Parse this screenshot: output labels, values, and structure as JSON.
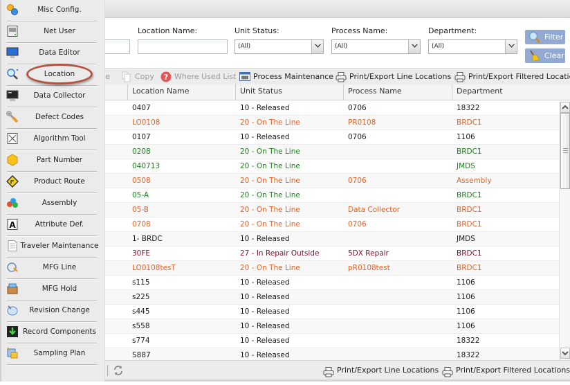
{
  "sidebar": {
    "items": [
      {
        "label": "Misc Config.",
        "icon": "gears-icon"
      },
      {
        "label": "Net User",
        "icon": "server-icon"
      },
      {
        "label": "Data Editor",
        "icon": "monitor-icon"
      },
      {
        "label": "Location",
        "icon": "magnifier-icon",
        "highlighted": true
      },
      {
        "label": "Data Collector",
        "icon": "terminal-icon"
      },
      {
        "label": "Defect Codes",
        "icon": "wrench-icon"
      },
      {
        "label": "Algorithm Tool",
        "icon": "algorithm-icon"
      },
      {
        "label": "Part Number",
        "icon": "hexagon-icon"
      },
      {
        "label": "Product Route",
        "icon": "route-sign-icon"
      },
      {
        "label": "Assembly",
        "icon": "molecules-icon"
      },
      {
        "label": "Attribute Def.",
        "icon": "letter-a-icon"
      },
      {
        "label": "Traveler Maintenance",
        "icon": "document-icon"
      },
      {
        "label": "MFG Line",
        "icon": "plug-icon"
      },
      {
        "label": "MFG Hold",
        "icon": "box-icon"
      },
      {
        "label": "Revision Change",
        "icon": "hand-icon"
      },
      {
        "label": "Record Components",
        "icon": "download-icon"
      },
      {
        "label": "Sampling Plan",
        "icon": "sampling-icon"
      }
    ]
  },
  "filters": {
    "location_name_label": "Location Name:",
    "location_name_value": "",
    "unit_status_label": "Unit Status:",
    "unit_status_value": "(All)",
    "process_name_label": "Process Name:",
    "process_name_value": "(All)",
    "department_label": "Department:",
    "department_value": "(All)",
    "filter_button": "Filter",
    "clear_button": "Clear"
  },
  "toolbar": {
    "delete_partial": "te",
    "copy": "Copy",
    "where_used": "Where Used List",
    "process_maintenance": "Process Maintenance",
    "print_line": "Print/Export Line Locations",
    "print_filtered": "Print/Export Filtered Locations"
  },
  "grid": {
    "columns": [
      "Location Name",
      "Unit Status",
      "Process Name",
      "Department"
    ],
    "colors": {
      "released": "#1a1a1a",
      "online_orange": "#e0632a",
      "online_green": "#1e7d1e",
      "repair": "#7a0f2a"
    },
    "rows": [
      {
        "location": "0407",
        "status": "10 - Released",
        "process": "0706",
        "department": "18322",
        "color": "#1a1a1a"
      },
      {
        "location": "LO0108",
        "status": "20 - On The Line",
        "process": "PR0108",
        "department": "BRDC1",
        "color": "#e0632a"
      },
      {
        "location": "0107",
        "status": "10 - Released",
        "process": "0706",
        "department": "1106",
        "color": "#1a1a1a"
      },
      {
        "location": "0208",
        "status": "20 - On The Line",
        "process": "",
        "department": "BRDC1",
        "color": "#1e7d1e"
      },
      {
        "location": "040713",
        "status": "20 - On The Line",
        "process": "",
        "department": "JMDS",
        "color": "#1e7d1e"
      },
      {
        "location": "0508",
        "status": "20 - On The Line",
        "process": "0706",
        "department": "Assembly",
        "color": "#e0632a"
      },
      {
        "location": "05-A",
        "status": "20 - On The Line",
        "process": "",
        "department": "BRDC1",
        "color": "#1e7d1e"
      },
      {
        "location": "05-B",
        "status": "20 - On The Line",
        "process": "Data Collector",
        "department": "BRDC1",
        "color": "#e0632a"
      },
      {
        "location": "0708",
        "status": "20 - On The Line",
        "process": "0706",
        "department": "BRDC1",
        "color": "#e0632a"
      },
      {
        "location": "1- BRDC",
        "status": "10 - Released",
        "process": "",
        "department": "JMDS",
        "color": "#1a1a1a"
      },
      {
        "location": "30FE",
        "status": "27 - In Repair Outside",
        "process": "5DX Repair",
        "department": "BRDC1",
        "color": "#7a0f2a"
      },
      {
        "location": "LO0108tesT",
        "status": "20 - On The Line",
        "process": "pR0108test",
        "department": "BRDC1",
        "color": "#e0632a"
      },
      {
        "location": "s115",
        "status": "10 - Released",
        "process": "",
        "department": "1106",
        "color": "#1a1a1a"
      },
      {
        "location": "s225",
        "status": "10 - Released",
        "process": "",
        "department": "1106",
        "color": "#1a1a1a"
      },
      {
        "location": "s445",
        "status": "10 - Released",
        "process": "",
        "department": "1106",
        "color": "#1a1a1a"
      },
      {
        "location": "s558",
        "status": "10 - Released",
        "process": "",
        "department": "1106",
        "color": "#1a1a1a"
      },
      {
        "location": "s774",
        "status": "10 - Released",
        "process": "",
        "department": "18322",
        "color": "#1a1a1a"
      },
      {
        "location": "S887",
        "status": "10 - Released",
        "process": "",
        "department": "18322",
        "color": "#1a1a1a"
      }
    ]
  },
  "footer": {
    "print_line": "Print/Export Line Locations",
    "print_filtered": "Print/Export Filtered Locations"
  }
}
